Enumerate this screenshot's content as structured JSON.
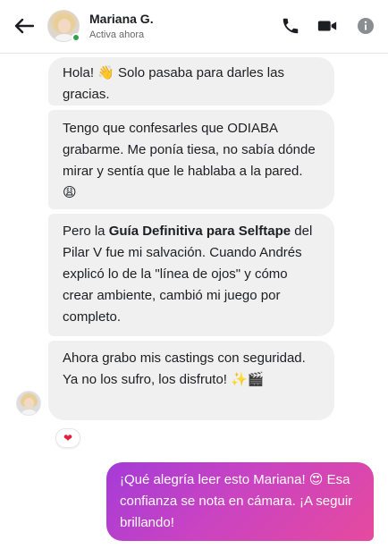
{
  "header": {
    "name": "Mariana G.",
    "status": "Activa ahora",
    "online_color": "#31a24c",
    "icons": [
      "back-arrow-icon",
      "phone-icon",
      "video-camera-icon",
      "info-icon"
    ]
  },
  "messages": [
    {
      "text": "Hola! 👋 Solo pasaba para darles las gracias."
    },
    {
      "text": "Tengo que confesarles que ODIABA grabarme. Me ponía tiesa, no sabía dónde mirar y sentía que le hablaba a la pared. 😩"
    },
    {
      "text_before": "Pero la ",
      "bold": "Guía Definitiva para Selftape",
      "text_after": " del Pilar V fue mi salvación. Cuando Andrés explicó lo de la \"línea de ojos\" y cómo crear ambiente, cambió mi juego por completo."
    },
    {
      "text": "Ahora grabo mis castings con seguridad. Ya no los sufro, los disfruto! ✨🎬"
    }
  ],
  "reaction": "❤",
  "outgoing": {
    "text": "¡Qué alegría leer esto Mariana! 😍 Esa confianza se nota en cámara. ¡A seguir brillando!",
    "gradient": [
      "#a53bd8",
      "#e64a9e"
    ]
  }
}
